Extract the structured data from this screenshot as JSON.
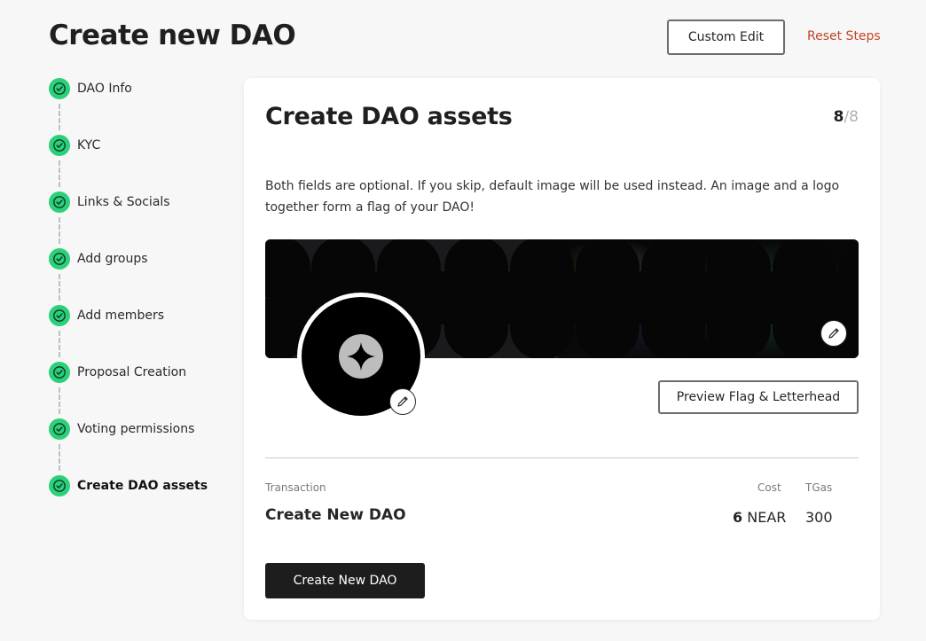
{
  "header": {
    "title": "Create new DAO",
    "custom_edit_label": "Custom Edit",
    "reset_steps_label": "Reset Steps"
  },
  "steps": [
    {
      "label": "DAO Info",
      "status": "complete"
    },
    {
      "label": "KYC",
      "status": "complete"
    },
    {
      "label": "Links & Socials",
      "status": "complete"
    },
    {
      "label": "Add groups",
      "status": "complete"
    },
    {
      "label": "Add members",
      "status": "complete"
    },
    {
      "label": "Proposal Creation",
      "status": "complete"
    },
    {
      "label": "Voting permissions",
      "status": "complete"
    },
    {
      "label": "Create DAO assets",
      "status": "current"
    }
  ],
  "card": {
    "title": "Create DAO assets",
    "step_current": "8",
    "step_total": "/8",
    "description": "Both fields are optional. If you skip, default image will be used instead. An image and a logo together form a flag of your DAO!",
    "preview_label": "Preview Flag & Letterhead",
    "transaction": {
      "label": "Transaction",
      "name": "Create New DAO",
      "cost_label": "Cost",
      "cost_amount": "6",
      "cost_unit": "NEAR",
      "tgas_label": "TGas",
      "tgas_value": "300"
    },
    "submit_label": "Create New DAO"
  },
  "colors": {
    "accent_green": "#2cd07a",
    "reset_link": "#c1452a",
    "primary_button": "#1d1d1d"
  }
}
